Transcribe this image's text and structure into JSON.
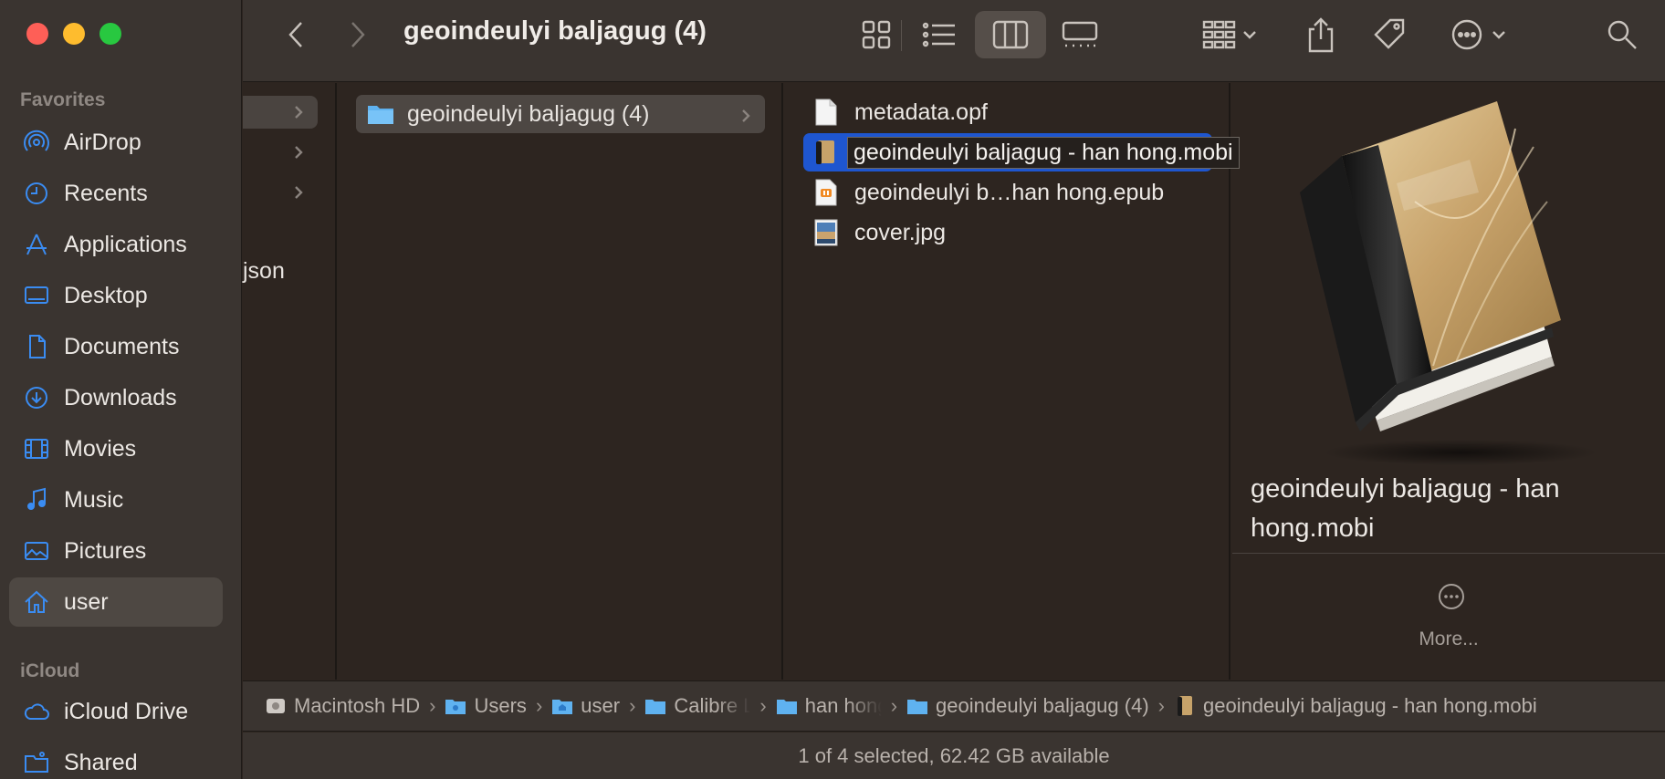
{
  "window": {
    "title": "geoindeulyi baljagug (4)"
  },
  "sidebar": {
    "favorites_heading": "Favorites",
    "icloud_heading": "iCloud",
    "items": [
      {
        "label": "AirDrop",
        "icon": "airdrop-icon"
      },
      {
        "label": "Recents",
        "icon": "clock-icon"
      },
      {
        "label": "Applications",
        "icon": "applications-icon"
      },
      {
        "label": "Desktop",
        "icon": "desktop-icon"
      },
      {
        "label": "Documents",
        "icon": "document-icon"
      },
      {
        "label": "Downloads",
        "icon": "download-icon"
      },
      {
        "label": "Movies",
        "icon": "film-icon"
      },
      {
        "label": "Music",
        "icon": "music-note-icon"
      },
      {
        "label": "Pictures",
        "icon": "photo-icon"
      },
      {
        "label": "user",
        "icon": "home-icon",
        "selected": true
      }
    ],
    "icloud_items": [
      {
        "label": "iCloud Drive",
        "icon": "cloud-icon"
      },
      {
        "label": "Shared",
        "icon": "shared-folder-icon"
      }
    ]
  },
  "columns": {
    "col1_fragment": "json",
    "col2_item": "geoindeulyi baljagug (4)",
    "files": [
      {
        "name": "metadata.opf",
        "icon": "blank-document-icon"
      },
      {
        "name": "geoindeulyi baljagug - han hong.mobi",
        "icon": "ebook-icon",
        "selected": true
      },
      {
        "name": "geoindeulyi b…han hong.epub",
        "icon": "epub-icon"
      },
      {
        "name": "cover.jpg",
        "icon": "image-file-icon"
      }
    ]
  },
  "preview": {
    "name": "geoindeulyi baljagug - han hong.mobi",
    "more_label": "More..."
  },
  "pathbar": [
    {
      "label": "Macintosh HD",
      "icon": "hard-drive-icon"
    },
    {
      "label": "Users",
      "icon": "folder-icon"
    },
    {
      "label": "user",
      "icon": "home-folder-icon"
    },
    {
      "label": "Calibre L",
      "icon": "folder-icon",
      "truncated": true
    },
    {
      "label": "han hong",
      "icon": "folder-icon",
      "truncated": true
    },
    {
      "label": "geoindeulyi baljagug (4)",
      "icon": "folder-icon"
    },
    {
      "label": "geoindeulyi baljagug - han hong.mobi",
      "icon": "ebook-icon"
    }
  ],
  "status": {
    "text": "1 of 4 selected, 62.42 GB available"
  },
  "colors": {
    "accent": "#3a8cf2",
    "selection": "#1e56d0"
  }
}
